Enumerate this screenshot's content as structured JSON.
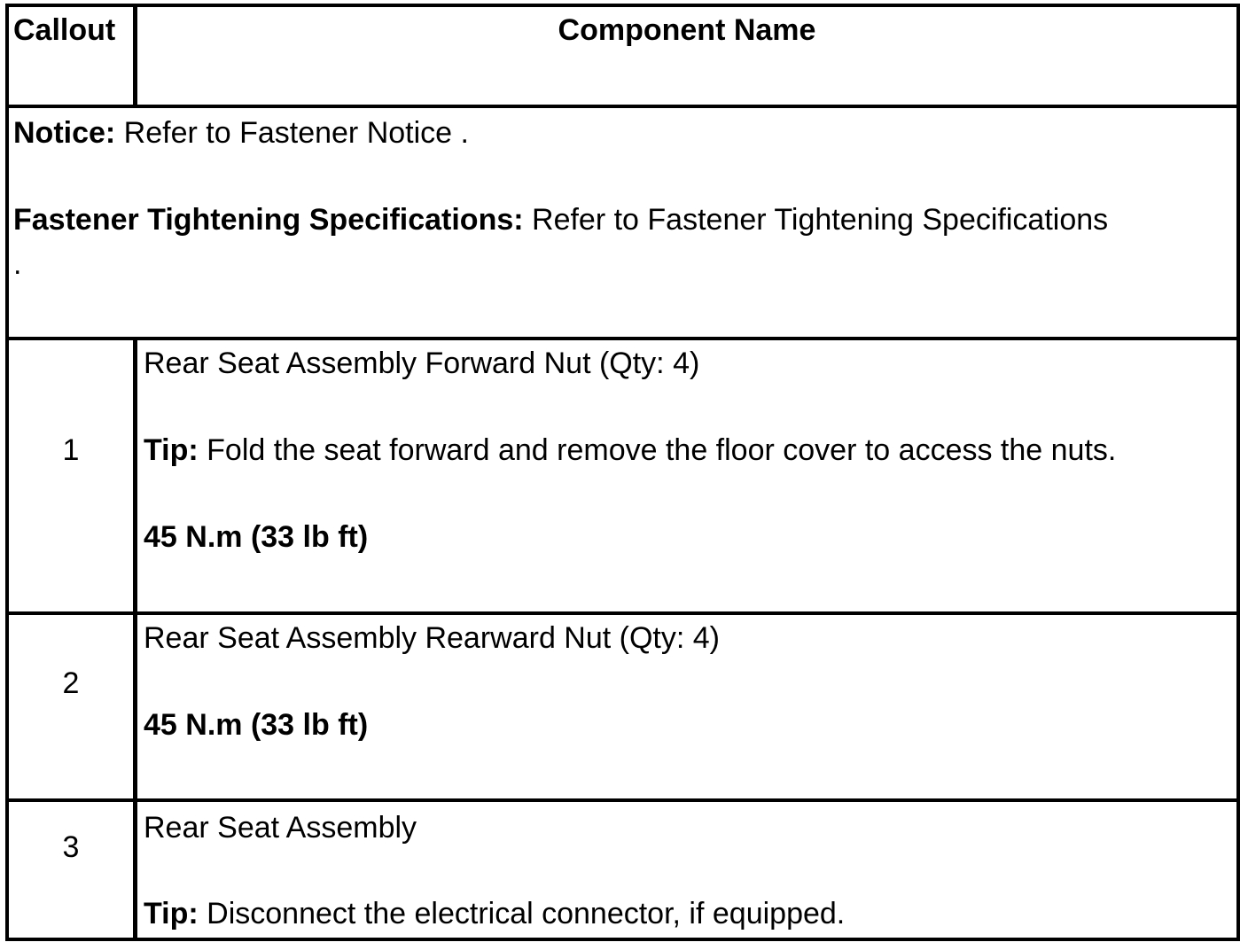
{
  "header": {
    "callout_label": "Callout",
    "component_label": "Component Name"
  },
  "notice": {
    "notice_label": "Notice:",
    "notice_text": " Refer to Fastener Notice .",
    "spec_label": "Fastener Tightening Specifications:",
    "spec_text": " Refer to Fastener Tightening Specifications",
    "spec_tail": "."
  },
  "rows": [
    {
      "callout": "1",
      "name": "Rear Seat Assembly Forward Nut (Qty: 4)",
      "tip_label": "Tip:",
      "tip_text": " Fold the seat forward and remove the floor cover to access the nuts.",
      "torque": "45 N.m (33 lb ft)"
    },
    {
      "callout": "2",
      "name": "Rear Seat Assembly Rearward Nut (Qty: 4)",
      "torque": "45 N.m (33 lb ft)"
    },
    {
      "callout": "3",
      "name": "Rear Seat Assembly",
      "tip_label": "Tip:",
      "tip_text": " Disconnect the electrical connector, if equipped."
    }
  ]
}
